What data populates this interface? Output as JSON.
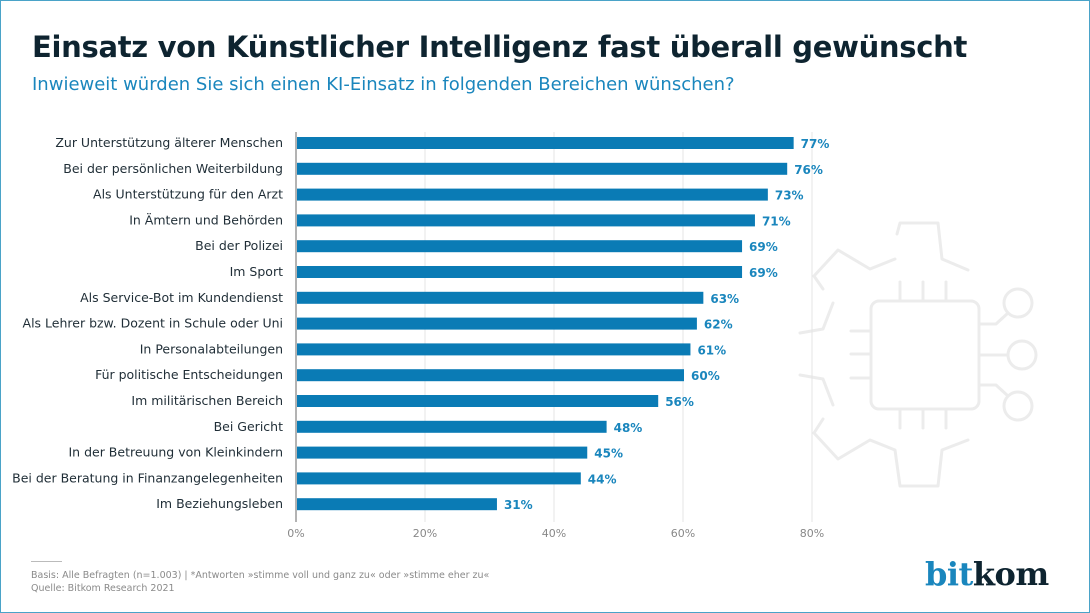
{
  "header": {
    "title": "Einsatz von Künstlicher Intelligenz fast überall gewünscht",
    "subtitle": "Inwieweit würden Sie sich einen KI-Einsatz in folgenden Bereichen wünschen?"
  },
  "chart_data": {
    "type": "bar",
    "orientation": "horizontal",
    "title": "Einsatz von Künstlicher Intelligenz fast überall gewünscht",
    "subtitle": "Inwieweit würden Sie sich einen KI-Einsatz in folgenden Bereichen wünschen?",
    "xlabel": "",
    "ylabel": "",
    "xlim": [
      0,
      80
    ],
    "xticks": [
      0,
      20,
      40,
      60,
      80
    ],
    "xtick_labels": [
      "0%",
      "20%",
      "40%",
      "60%",
      "80%"
    ],
    "grid": true,
    "unit": "%",
    "categories": [
      "Zur Unterstützung älterer Menschen",
      "Bei der persönlichen Weiterbildung",
      "Als Unterstützung für den Arzt",
      "In Ämtern und Behörden",
      "Bei der Polizei",
      "Im Sport",
      "Als Service-Bot im Kundendienst",
      "Als Lehrer bzw. Dozent in Schule oder Uni",
      "In Personalabteilungen",
      "Für politische Entscheidungen",
      "Im militärischen Bereich",
      "Bei Gericht",
      "In der Betreuung von Kleinkindern",
      "Bei der Beratung in Finanzangelegenheiten",
      "Im Beziehungsleben"
    ],
    "values": [
      77,
      76,
      73,
      71,
      69,
      69,
      63,
      62,
      61,
      60,
      56,
      48,
      45,
      44,
      31
    ],
    "value_labels": [
      "77%",
      "76%",
      "73%",
      "71%",
      "69%",
      "69%",
      "63%",
      "62%",
      "61%",
      "60%",
      "56%",
      "48%",
      "45%",
      "44%",
      "31%"
    ],
    "bar_color": "#0a7bb5",
    "label_color": "#1a86bd"
  },
  "footer": {
    "basis": "Basis: Alle Befragten (n=1.003) | *Antworten »stimme voll und ganz zu« oder »stimme eher zu«",
    "source": "Quelle: Bitkom Research 2021"
  },
  "logo": {
    "part1": "bit",
    "part2": "kom"
  },
  "background_icon": "ai-chip-gear-icon"
}
